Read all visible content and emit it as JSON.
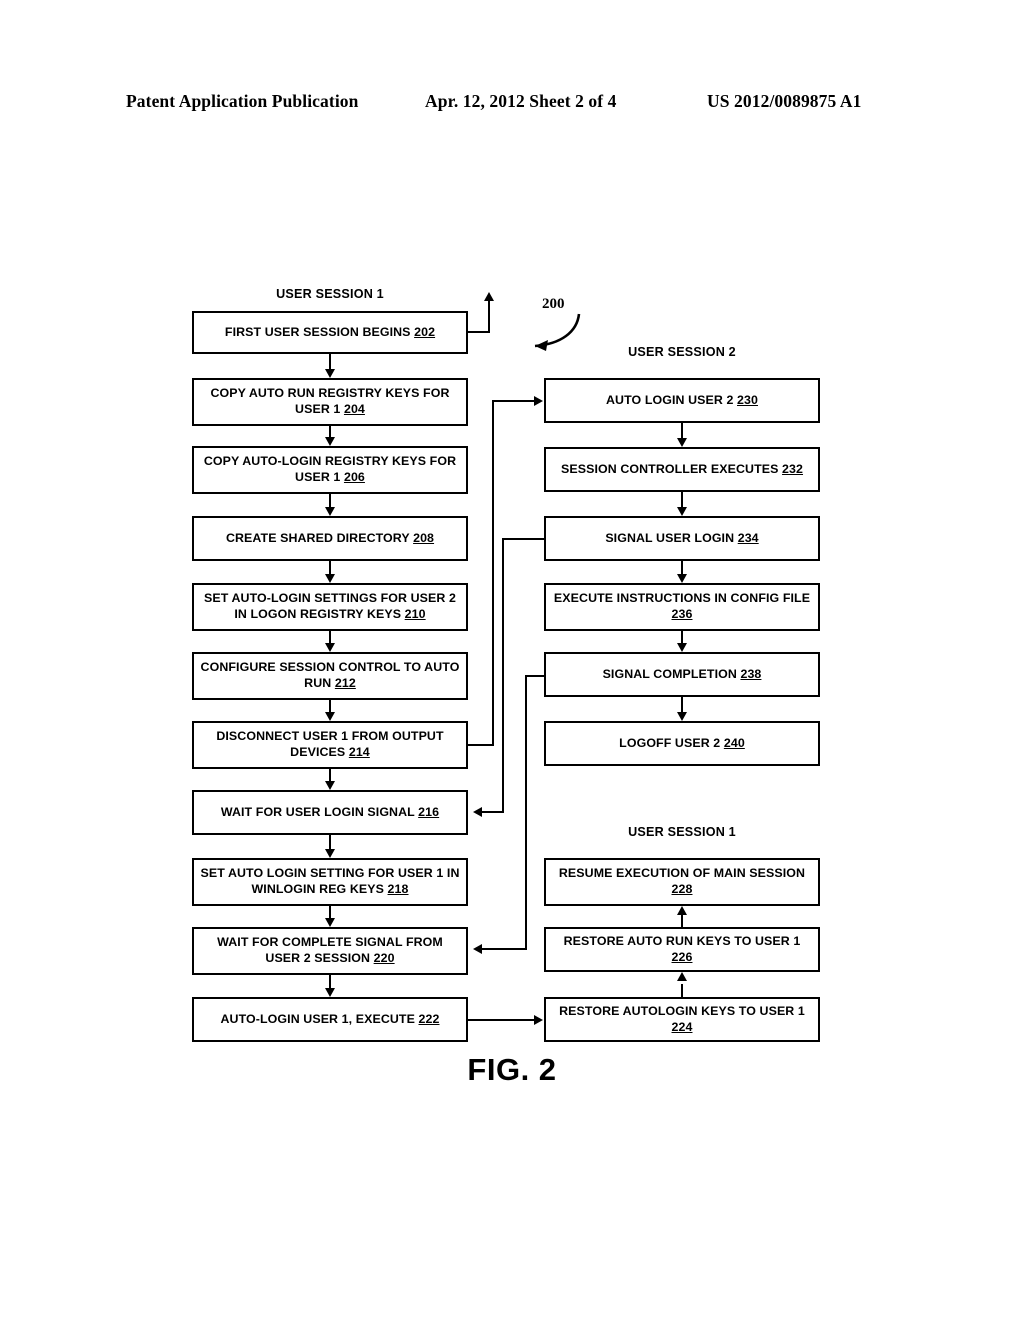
{
  "header": {
    "left": "Patent Application Publication",
    "middle": "Apr. 12, 2012  Sheet 2 of 4",
    "right": "US 2012/0089875 A1"
  },
  "figure": {
    "caption": "FIG. 2",
    "reference_numeral": "200",
    "group_labels": {
      "left_top": "USER SESSION 1",
      "right_top": "USER SESSION 2",
      "right_bottom": "USER SESSION 1"
    },
    "nodes": {
      "n202": {
        "text": "FIRST USER SESSION BEGINS",
        "ref": "202"
      },
      "n204": {
        "text": "COPY AUTO RUN REGISTRY KEYS FOR USER 1",
        "ref": "204"
      },
      "n206": {
        "text": "COPY AUTO-LOGIN REGISTRY KEYS FOR USER 1",
        "ref": "206"
      },
      "n208": {
        "text": "CREATE SHARED DIRECTORY",
        "ref": "208"
      },
      "n210": {
        "text": "SET AUTO-LOGIN SETTINGS FOR USER 2 IN LOGON REGISTRY KEYS",
        "ref": "210"
      },
      "n212": {
        "text": "CONFIGURE SESSION CONTROL TO AUTO RUN",
        "ref": "212"
      },
      "n214": {
        "text": "DISCONNECT USER 1 FROM OUTPUT DEVICES",
        "ref": "214"
      },
      "n216": {
        "text": "WAIT FOR USER LOGIN SIGNAL",
        "ref": "216"
      },
      "n218": {
        "text": "SET AUTO LOGIN SETTING FOR USER 1 IN WINLOGIN REG KEYS",
        "ref": "218"
      },
      "n220": {
        "text": "WAIT FOR COMPLETE SIGNAL FROM USER 2 SESSION",
        "ref": "220"
      },
      "n222": {
        "text": "AUTO-LOGIN USER 1, EXECUTE",
        "ref": "222"
      },
      "n230": {
        "text": "AUTO LOGIN USER 2",
        "ref": "230"
      },
      "n232": {
        "text": "SESSION CONTROLLER EXECUTES",
        "ref": "232"
      },
      "n234": {
        "text": "SIGNAL USER LOGIN",
        "ref": "234"
      },
      "n236": {
        "text": "EXECUTE INSTRUCTIONS IN CONFIG FILE",
        "ref": "236"
      },
      "n238": {
        "text": "SIGNAL COMPLETION",
        "ref": "238"
      },
      "n240": {
        "text": "LOGOFF USER 2",
        "ref": "240"
      },
      "n228": {
        "text": "RESUME EXECUTION OF MAIN SESSION",
        "ref": "228"
      },
      "n226": {
        "text": "RESTORE AUTO RUN KEYS TO USER 1",
        "ref": "226"
      },
      "n224": {
        "text": "RESTORE AUTOLOGIN KEYS TO USER 1",
        "ref": "224"
      }
    }
  }
}
